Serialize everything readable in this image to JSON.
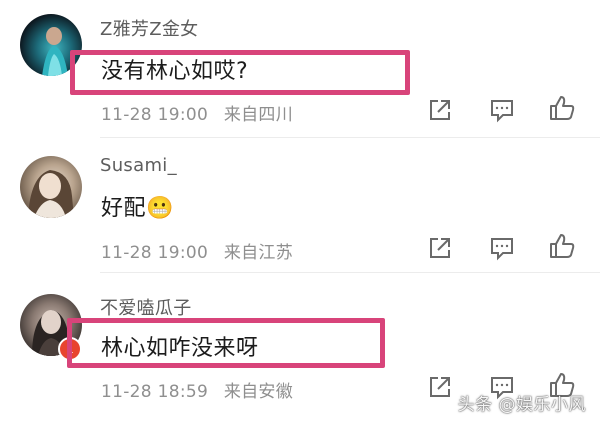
{
  "comments": [
    {
      "username": "Z雅芳Z金女",
      "text": "没有林心如哎?",
      "time": "11-28 19:00",
      "location": "来自四川",
      "avatar_icon": "avatar-dark-dress"
    },
    {
      "username": "Susami_",
      "text": "好配😬",
      "time": "11-28 19:00",
      "location": "来自江苏",
      "avatar_icon": "avatar-portrait"
    },
    {
      "username": "不爱嗑瓜子",
      "text": "林心如咋没来呀",
      "time": "11-28 18:59",
      "location": "来自安徽",
      "avatar_icon": "avatar-portrait-dark",
      "badge": "1"
    }
  ],
  "colors": {
    "highlight": "#d8447a",
    "username": "#5d5d5d",
    "text": "#1c1c1c",
    "meta": "#8f8f8f",
    "badge": "#e8442f"
  },
  "watermark": "头条 @娱乐小风"
}
